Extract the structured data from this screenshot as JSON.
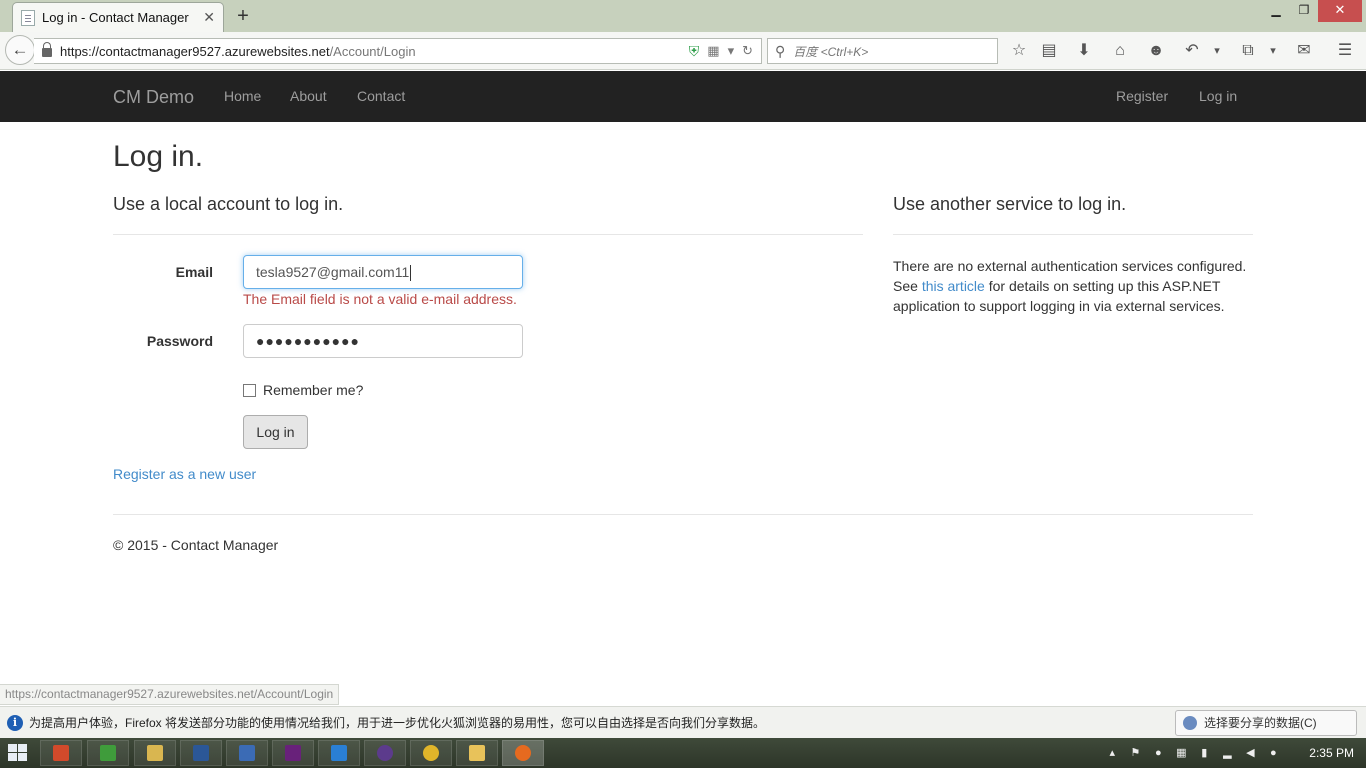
{
  "browser": {
    "tab_title": "Log in - Contact Manager",
    "url_host": "https://contactmanager9527.azurewebsites.net",
    "url_path": "/Account/Login",
    "search_placeholder": "百度 <Ctrl+K>",
    "status_url": "https://contactmanager9527.azurewebsites.net/Account/Login"
  },
  "site": {
    "brand": "CM Demo",
    "nav": {
      "home": "Home",
      "about": "About",
      "contact": "Contact",
      "register": "Register",
      "login": "Log in"
    }
  },
  "page": {
    "title": "Log in.",
    "local_heading": "Use a local account to log in.",
    "email_label": "Email",
    "email_value": "tesla9527@gmail.com11",
    "email_error": "The Email field is not a valid e-mail address.",
    "password_label": "Password",
    "password_masked": "●●●●●●●●●●●",
    "remember_label": "Remember me?",
    "login_button": "Log in",
    "register_link": "Register as a new user",
    "external_heading": "Use another service to log in.",
    "external_text_1": "There are no external authentication services configured. See ",
    "external_link": "this article",
    "external_text_2": " for details on setting up this ASP.NET application to support logging in via external services.",
    "footer": "© 2015 - Contact Manager"
  },
  "notification": {
    "message": "为提高用户体验，Firefox 将发送部分功能的使用情况给我们，用于进一步优化火狐浏览器的易用性，您可以自由选择是否向我们分享数据。",
    "button": "选择要分享的数据(C)"
  },
  "taskbar": {
    "clock": "2:35 PM"
  },
  "colors": {
    "navbar_bg": "#222222",
    "nav_text": "#9d9d9d",
    "link": "#428bca",
    "error": "#b94a48"
  }
}
